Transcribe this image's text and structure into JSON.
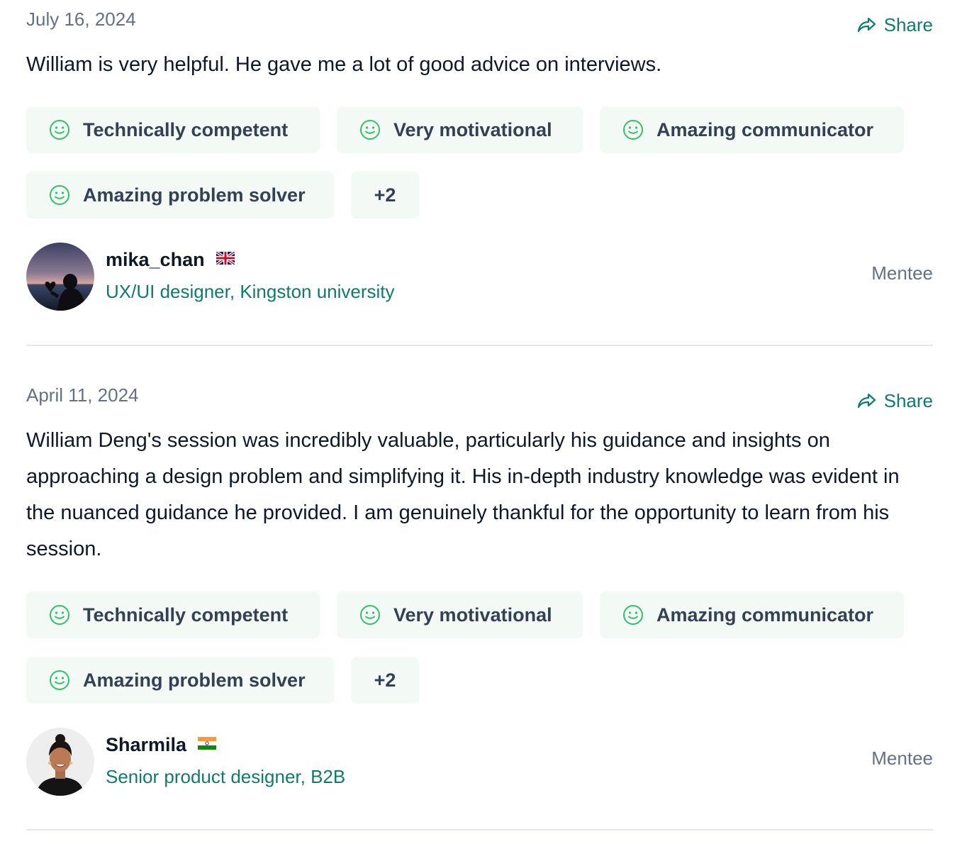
{
  "reviews": [
    {
      "date": "July 16, 2024",
      "share_label": "Share",
      "text": "William is very helpful. He gave me a lot of good advice on interviews.",
      "tags": [
        "Technically competent",
        "Very motivational",
        "Amazing communicator",
        "Amazing problem solver"
      ],
      "more_tags": "+2",
      "author": {
        "name": "mika_chan",
        "flag": "uk-flag-icon",
        "title": "UX/UI designer, Kingston university",
        "role": "Mentee"
      }
    },
    {
      "date": "April 11, 2024",
      "share_label": "Share",
      "text": "William Deng's session was incredibly valuable, particularly his guidance and insights on approaching a design problem and simplifying it. His in-depth industry knowledge was evident in the nuanced guidance he provided. I am genuinely thankful for the opportunity to learn from his session.",
      "tags": [
        "Technically competent",
        "Very motivational",
        "Amazing communicator",
        "Amazing problem solver"
      ],
      "more_tags": "+2",
      "author": {
        "name": "Sharmila",
        "flag": "india-flag-icon",
        "title": "Senior product designer, B2B",
        "role": "Mentee"
      }
    }
  ],
  "colors": {
    "accent": "#0f7b6c",
    "tag_background": "#f3faf5",
    "smile_icon": "#34c06a",
    "muted_text": "#667085",
    "divider": "#e4e7ec"
  }
}
